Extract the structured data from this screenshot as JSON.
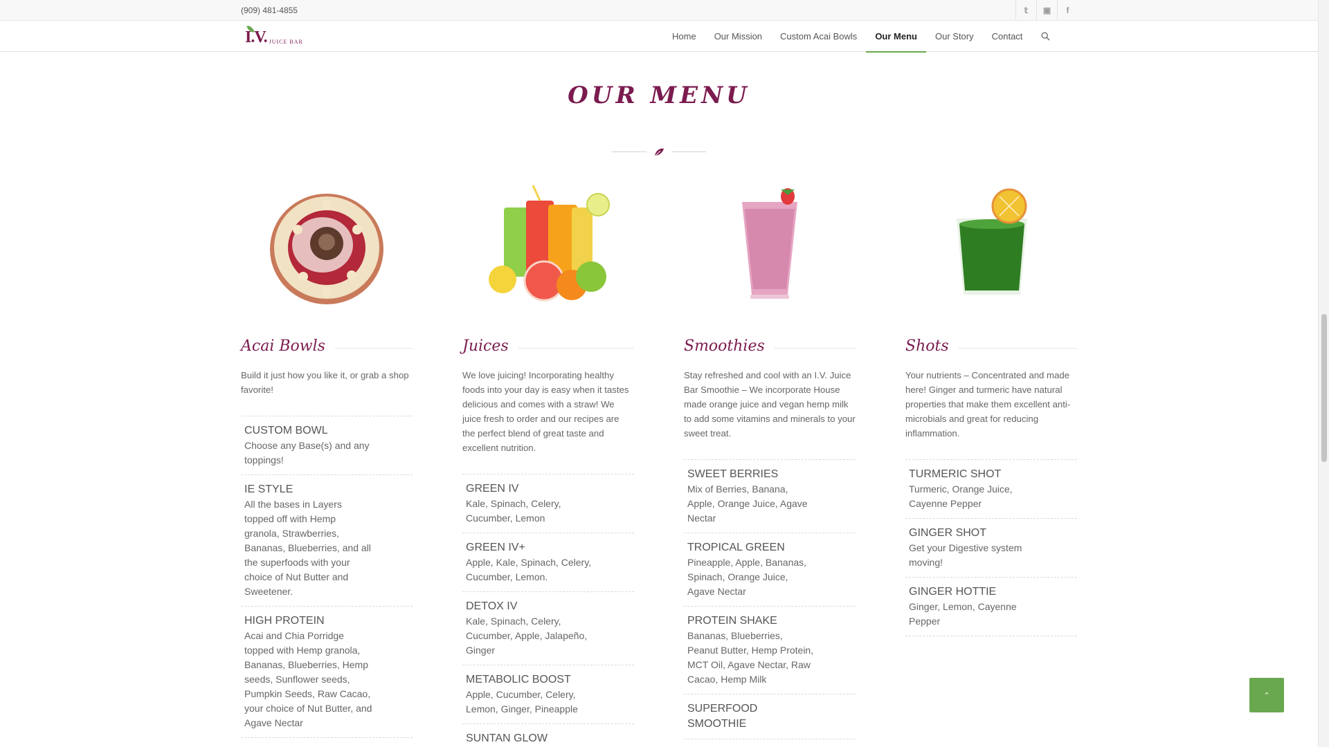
{
  "topbar": {
    "phone": "(909) 481-4855",
    "social": [
      {
        "icon": "twitter-icon",
        "glyph": "𝕥"
      },
      {
        "icon": "instagram-icon",
        "glyph": "▣"
      },
      {
        "icon": "facebook-icon",
        "glyph": "f"
      }
    ]
  },
  "logo": {
    "mark": "I.V.",
    "sub": "JUICE BAR"
  },
  "nav": {
    "items": [
      "Home",
      "Our Mission",
      "Custom Acai Bowls",
      "Our Menu",
      "Our Story",
      "Contact"
    ],
    "active": "Our Menu",
    "search_icon": "search-icon"
  },
  "page": {
    "title": "OUR MENU"
  },
  "colors": {
    "brand": "#7b1b4f",
    "accent": "#6aa84f",
    "text": "#666666"
  },
  "columns": [
    {
      "title": "Acai Bowls",
      "image_icon": "acai-bowl-image",
      "description": "Build it just how you like it, or grab a shop favorite!",
      "items": [
        {
          "name": "CUSTOM BOWL",
          "desc": "Choose any Base(s) and any toppings!"
        },
        {
          "name": "IE STYLE",
          "desc": "All the bases in Layers topped off with Hemp granola, Strawberries, Bananas, Blueberries, and all the superfoods with your choice of Nut Butter and Sweetener."
        },
        {
          "name": "HIGH PROTEIN",
          "desc": "Acai and Chia Porridge topped with Hemp granola, Bananas, Blueberries, Hemp seeds, Sunflower seeds, Pumpkin Seeds, Raw Cacao, your choice of Nut Butter, and Agave Nectar"
        }
      ]
    },
    {
      "title": "Juices",
      "image_icon": "juice-glasses-image",
      "description": "We love juicing! Incorporating healthy foods into your day is easy when it tastes delicious and comes with a straw! We juice fresh to order and our recipes are the perfect blend of great taste and excellent nutrition.",
      "items": [
        {
          "name": "GREEN IV",
          "desc": "Kale, Spinach, Celery, Cucumber, Lemon"
        },
        {
          "name": "GREEN IV+",
          "desc": "Apple, Kale, Spinach, Celery, Cucumber, Lemon."
        },
        {
          "name": "DETOX IV",
          "desc": "Kale, Spinach, Celery, Cucumber, Apple, Jalapeño, Ginger"
        },
        {
          "name": "METABOLIC BOOST",
          "desc": "Apple, Cucumber, Celery, Lemon, Ginger, Pineapple"
        },
        {
          "name": "SUNTAN GLOW",
          "desc": ""
        }
      ]
    },
    {
      "title": "Smoothies",
      "image_icon": "smoothie-glass-image",
      "description": "Stay refreshed and cool with an I.V. Juice Bar Smoothie – We incorporate House made orange juice and vegan hemp milk to add some vitamins and minerals to your sweet treat.",
      "items": [
        {
          "name": "SWEET BERRIES",
          "desc": "Mix of Berries, Banana, Apple, Orange Juice, Agave Nectar"
        },
        {
          "name": "TROPICAL GREEN",
          "desc": "Pineapple, Apple, Bananas, Spinach, Orange Juice, Agave Nectar"
        },
        {
          "name": "PROTEIN SHAKE",
          "desc": "Bananas, Blueberries, Peanut Butter, Hemp Protein, MCT Oil, Agave Nectar, Raw Cacao, Hemp Milk"
        },
        {
          "name": "SUPERFOOD SMOOTHIE",
          "desc": ""
        }
      ]
    },
    {
      "title": "Shots",
      "image_icon": "green-shot-image",
      "description": "Your nutrients – Concentrated and made here! Ginger and turmeric have natural properties that make them excellent anti-microbials and great for reducing inflammation.",
      "items": [
        {
          "name": "TURMERIC SHOT",
          "desc": "Turmeric, Orange Juice, Cayenne Pepper"
        },
        {
          "name": "GINGER SHOT",
          "desc": "Get your Digestive system moving!"
        },
        {
          "name": "GINGER HOTTIE",
          "desc": "Ginger, Lemon, Cayenne Pepper"
        }
      ]
    }
  ],
  "back_to_top": {
    "glyph": "⌃"
  }
}
